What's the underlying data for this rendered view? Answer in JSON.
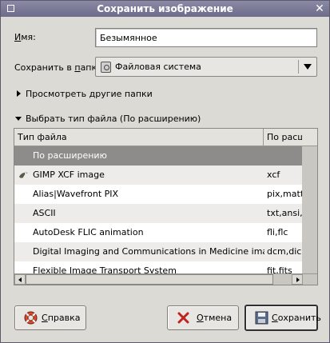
{
  "window": {
    "title": "Сохранить изображение",
    "menu_icon": "window-menu-icon",
    "close_icon": "close-icon"
  },
  "name_field": {
    "label_accel": "И",
    "label_rest": "мя:",
    "value": "Безымянное"
  },
  "folder": {
    "label_prefix": "Сохранить в ",
    "label_accel": "п",
    "label_rest": "апке",
    "selected": "Файловая система",
    "icon": "harddisk-icon"
  },
  "browse": {
    "label": "Просмотреть другие папки",
    "expanded": false
  },
  "file_type": {
    "label": "Выбрать тип файла (По расширению)",
    "expanded": true,
    "columns": [
      "Тип файла",
      "По расш"
    ],
    "rows": [
      {
        "type": "По расширению",
        "ext": "",
        "selected": true
      },
      {
        "type": "GIMP XCF image",
        "ext": "xcf",
        "icon": "wilber-icon"
      },
      {
        "type": "Alias|Wavefront PIX",
        "ext": "pix,matt"
      },
      {
        "type": "ASCII",
        "ext": "txt,ansi,t"
      },
      {
        "type": "AutoDesk FLIC animation",
        "ext": "fli,flc"
      },
      {
        "type": "Digital Imaging and Communications in Medicine image",
        "ext": "dcm,dic"
      },
      {
        "type": "Flexible Image Transport System",
        "ext": "fit,fits"
      }
    ]
  },
  "buttons": {
    "help": {
      "accel": "С",
      "rest": "правка",
      "icon": "lifebuoy-icon"
    },
    "cancel": {
      "accel": "О",
      "rest": "тмена",
      "icon": "cancel-x-icon"
    },
    "save": {
      "accel": "С",
      "rest": "охранить",
      "icon": "floppy-icon"
    }
  },
  "colors": {
    "titlebar": "#7a7a96",
    "selection": "#8d8c8a",
    "dialog_bg": "#dcdad5"
  }
}
